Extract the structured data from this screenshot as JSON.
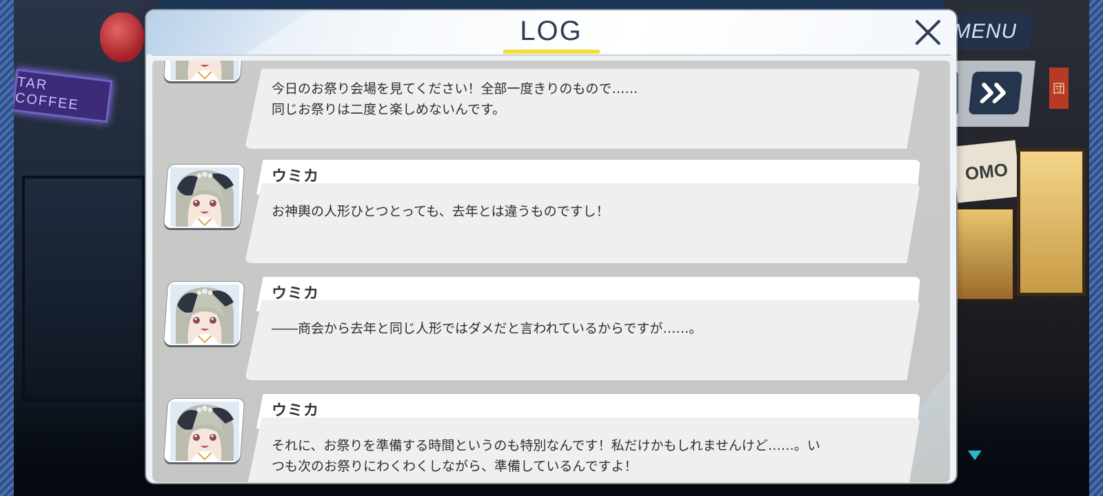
{
  "hud": {
    "menu_label": "MENU",
    "bg_shop_sign": "TAR COFFEE",
    "bg_store_sign": "OMO",
    "bg_kanji_sign": "団"
  },
  "log": {
    "title": "LOG",
    "entries": [
      {
        "speaker": "",
        "text": "今日のお祭り会場を見てください！全部一度きりのもので……\n同じお祭りは二度と楽しめないんです。"
      },
      {
        "speaker": "ウミカ",
        "text": "お神輿の人形ひとつとっても、去年とは違うものですし！"
      },
      {
        "speaker": "ウミカ",
        "text": "――商会から去年と同じ人形ではダメだと言われているからですが……。"
      },
      {
        "speaker": "ウミカ",
        "text": "それに、お祭りを準備する時間というのも特別なんです！私だけかもしれませんけど……。い\nつも次のお祭りにわくわくしながら、準備しているんですよ！"
      }
    ]
  },
  "colors": {
    "accent_yellow": "#f4dd37",
    "title_navy": "#2a3b55",
    "hud_navy": "#26354e",
    "indicator_teal": "#2fb7c4"
  }
}
